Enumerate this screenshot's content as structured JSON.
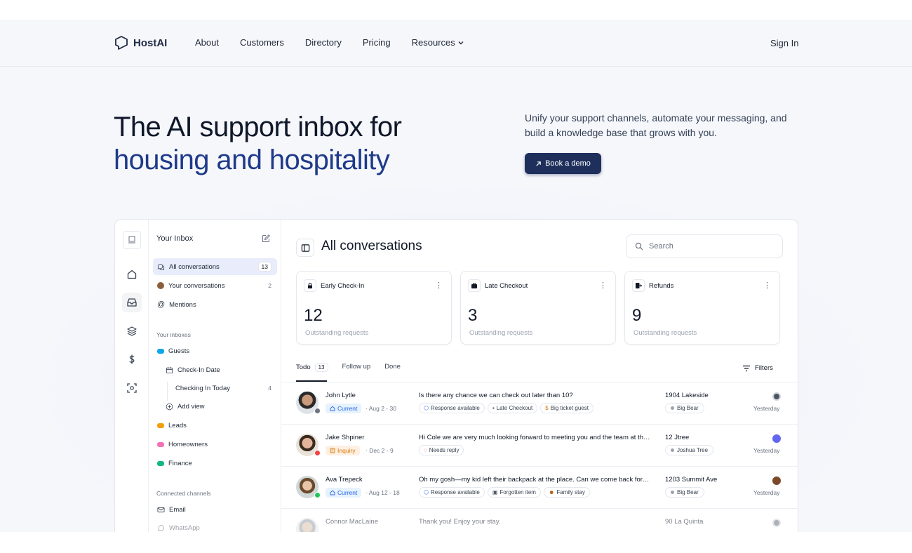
{
  "brand": {
    "name": "HostAI"
  },
  "nav": {
    "links": [
      "About",
      "Customers",
      "Directory",
      "Pricing",
      "Resources"
    ],
    "signin": "Sign In"
  },
  "hero": {
    "title_line1": "The AI support inbox for",
    "title_line2": "housing and hospitality",
    "subtitle": "Unify your support channels, automate your messaging, and build a knowledge base that grows with you.",
    "cta": "Book a demo"
  },
  "sidebar": {
    "title": "Your Inbox",
    "items": [
      {
        "label": "All conversations",
        "count": "13"
      },
      {
        "label": "Your conversations",
        "count": "2"
      },
      {
        "label": "Mentions",
        "count": ""
      }
    ],
    "inboxes_title": "Your inboxes",
    "inboxes": [
      {
        "label": "Guests"
      },
      {
        "label": "Check-In Date"
      },
      {
        "label": "Checking In Today",
        "count": "4"
      },
      {
        "label": "Add view"
      },
      {
        "label": "Leads"
      },
      {
        "label": "Homeowners"
      },
      {
        "label": "Finance"
      }
    ],
    "channels_title": "Connected channels",
    "channels": [
      {
        "label": "Email"
      },
      {
        "label": "WhatsApp"
      }
    ]
  },
  "main": {
    "title": "All conversations",
    "search_placeholder": "Search",
    "cards": [
      {
        "title": "Early Check-In",
        "value": "12",
        "sub": "Outstanding requests"
      },
      {
        "title": "Late Checkout",
        "value": "3",
        "sub": "Outstanding requests"
      },
      {
        "title": "Refunds",
        "value": "9",
        "sub": "Outstanding requests"
      }
    ],
    "tabs": [
      {
        "label": "Todo",
        "count": "13"
      },
      {
        "label": "Follow up"
      },
      {
        "label": "Done"
      }
    ],
    "filters_label": "Filters",
    "conversations": [
      {
        "name": "John Lytle",
        "status": "Current",
        "dates": "Aug 2 - 30",
        "message": "Is there any chance we can check out later than 10?",
        "tags": [
          "Response available",
          "Late Checkout",
          "Big ticket guest"
        ],
        "property": "1904 Lakeside",
        "owner": "Big Bear",
        "time": "Yesterday"
      },
      {
        "name": "Jake Shpiner",
        "status": "Inquiry",
        "dates": "Dec 2 - 9",
        "message": "Hi Cole we are very much looking forward to meeting you and the team at the property",
        "tags": [
          "Needs reply"
        ],
        "property": "12 Jtree",
        "owner": "Joshua Tree",
        "time": "Yesterday"
      },
      {
        "name": "Ava Trepeck",
        "status": "Current",
        "dates": "Aug 12 - 18",
        "message": "Oh my gosh—my kid left their backpack at the place. Can we come back for it?",
        "tags": [
          "Response available",
          "Forgotten item",
          "Family stay"
        ],
        "property": "1203 Summit Ave",
        "owner": "Big Bear",
        "time": "Yesterday"
      },
      {
        "name": "Connor MacLaine",
        "status": "",
        "dates": "",
        "message": "Thank you! Enjoy your stay.",
        "tags": [],
        "property": "90 La Quinta",
        "owner": "",
        "time": ""
      }
    ]
  },
  "colors": {
    "accent": "#1e3a8a",
    "cta_bg": "#1e2f5c",
    "active_bg": "#e8ecfb"
  }
}
